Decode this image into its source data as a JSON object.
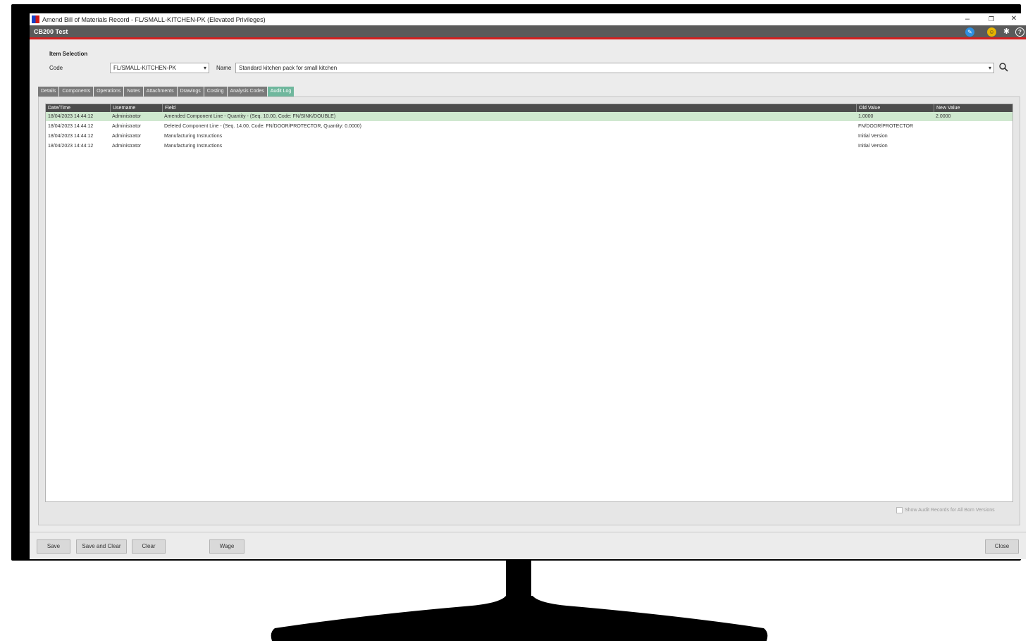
{
  "window": {
    "title": "Amend Bill of Materials Record - FL/SMALL-KITCHEN-PK (Elevated Privileges)",
    "minimize": "–",
    "restore": "❐",
    "close": "✕"
  },
  "appbar": {
    "company": "CB200 Test",
    "icons": [
      "edit-icon",
      "smiley-icon",
      "settings-icon",
      "help-icon"
    ],
    "colors": {
      "bar": "#5a5a5a",
      "accent": "#d31f1f",
      "tab_active": "#6fb79d",
      "row_selected": "#cfe8cf"
    }
  },
  "item_selection": {
    "section_label": "Item Selection",
    "code_label": "Code",
    "code_value": "FL/SMALL-KITCHEN-PK",
    "name_label": "Name",
    "name_value": "Standard kitchen pack for small kitchen"
  },
  "tabs": [
    {
      "label": "Details",
      "active": false
    },
    {
      "label": "Components",
      "active": false
    },
    {
      "label": "Operations",
      "active": false
    },
    {
      "label": "Notes",
      "active": false
    },
    {
      "label": "Attachments",
      "active": false
    },
    {
      "label": "Drawings",
      "active": false
    },
    {
      "label": "Costing",
      "active": false
    },
    {
      "label": "Analysis Codes",
      "active": false
    },
    {
      "label": "Audit Log",
      "active": true
    }
  ],
  "audit_table": {
    "columns": [
      "Date/Time",
      "Username",
      "Field",
      "Old Value",
      "New Value"
    ],
    "rows": [
      {
        "datetime": "18/04/2023 14:44:12",
        "username": "Administrator",
        "field": "Amended Component Line - Quantity - (Seq. 10.00, Code: FN/SINK/DOUBLE)",
        "old": "1.0000",
        "new": "2.0000",
        "selected": true
      },
      {
        "datetime": "18/04/2023 14:44:12",
        "username": "Administrator",
        "field": "Deleted Component Line - (Seq. 14.00, Code: FN/DOOR/PROTECTOR, Quantity: 0.0000)",
        "old": "FN/DOOR/PROTECTOR",
        "new": "",
        "selected": false
      },
      {
        "datetime": "18/04/2023 14:44:12",
        "username": "Administrator",
        "field": "Manufacturing Instructions",
        "old": "Initial Version",
        "new": "",
        "selected": false
      },
      {
        "datetime": "18/04/2023 14:44:12",
        "username": "Administrator",
        "field": "Manufacturing Instructions",
        "old": "Initial Version",
        "new": "",
        "selected": false
      }
    ]
  },
  "show_all_checkbox": {
    "label": "Show Audit Records for All Bom Versions",
    "checked": false
  },
  "buttons": {
    "save": "Save",
    "save_and_clear": "Save and Clear",
    "clear": "Clear",
    "wizard": "Wage",
    "close": "Close"
  }
}
